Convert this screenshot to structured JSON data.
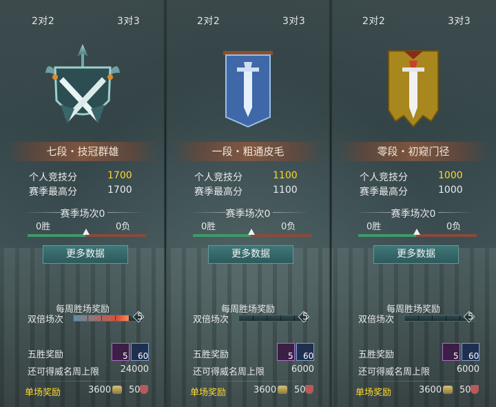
{
  "panels": [
    {
      "tabs": [
        "2对2",
        "3对3"
      ],
      "rank": "七段・技冠群雄",
      "personal_label": "个人竞技分",
      "personal_value": "1700",
      "season_high_label": "赛季最高分",
      "season_high_value": "1700",
      "season_matches": "赛季场次0",
      "wins": "0胜",
      "losses": "0负",
      "more_button": "更多数据",
      "weekly_title": "每周胜场奖励",
      "double_label": "双倍场次",
      "double_cap": "5",
      "double_progress": 0.8,
      "five_wins_label": "五胜奖励",
      "five_reward_1_qty": "5",
      "five_reward_2_qty": "60",
      "prestige_cap_label": "还可得威名周上限",
      "prestige_cap_value": "24000",
      "single_label": "单场奖励",
      "single_coins": "3600",
      "single_shield": "50"
    },
    {
      "tabs": [
        "2对2",
        "3对3"
      ],
      "rank": "一段・粗通皮毛",
      "personal_label": "个人竞技分",
      "personal_value": "1100",
      "season_high_label": "赛季最高分",
      "season_high_value": "1100",
      "season_matches": "赛季场次0",
      "wins": "0胜",
      "losses": "0负",
      "more_button": "更多数据",
      "weekly_title": "每周胜场奖励",
      "double_label": "双倍场次",
      "double_cap": "5",
      "double_progress": 0.0,
      "five_wins_label": "五胜奖励",
      "five_reward_1_qty": "5",
      "five_reward_2_qty": "60",
      "prestige_cap_label": "还可得威名周上限",
      "prestige_cap_value": "6000",
      "single_label": "单场奖励",
      "single_coins": "3600",
      "single_shield": "50"
    },
    {
      "tabs": [
        "2对2",
        "3对3"
      ],
      "rank": "零段・初窥门径",
      "personal_label": "个人竞技分",
      "personal_value": "1000",
      "season_high_label": "赛季最高分",
      "season_high_value": "1000",
      "season_matches": "赛季场次0",
      "wins": "0胜",
      "losses": "0负",
      "more_button": "更多数据",
      "weekly_title": "每周胜场奖励",
      "double_label": "双倍场次",
      "double_cap": "5",
      "double_progress": 0.0,
      "five_wins_label": "五胜奖励",
      "five_reward_1_qty": "5",
      "five_reward_2_qty": "60",
      "prestige_cap_label": "还可得威名周上限",
      "prestige_cap_value": "6000",
      "single_label": "单场奖励",
      "single_coins": "3600",
      "single_shield": "50"
    }
  ],
  "colors": {
    "gold": "#ffd92a",
    "win_bar": "#3f9a6a",
    "loss_bar": "#8a4a3a",
    "button": "#2d5a5c"
  },
  "icons": [
    "crossed-swords-crest-icon",
    "blue-sword-banner-icon",
    "gold-sword-banner-icon",
    "treasure-chest-icon",
    "feather-scroll-icon",
    "coin-icon",
    "shield-icon"
  ]
}
